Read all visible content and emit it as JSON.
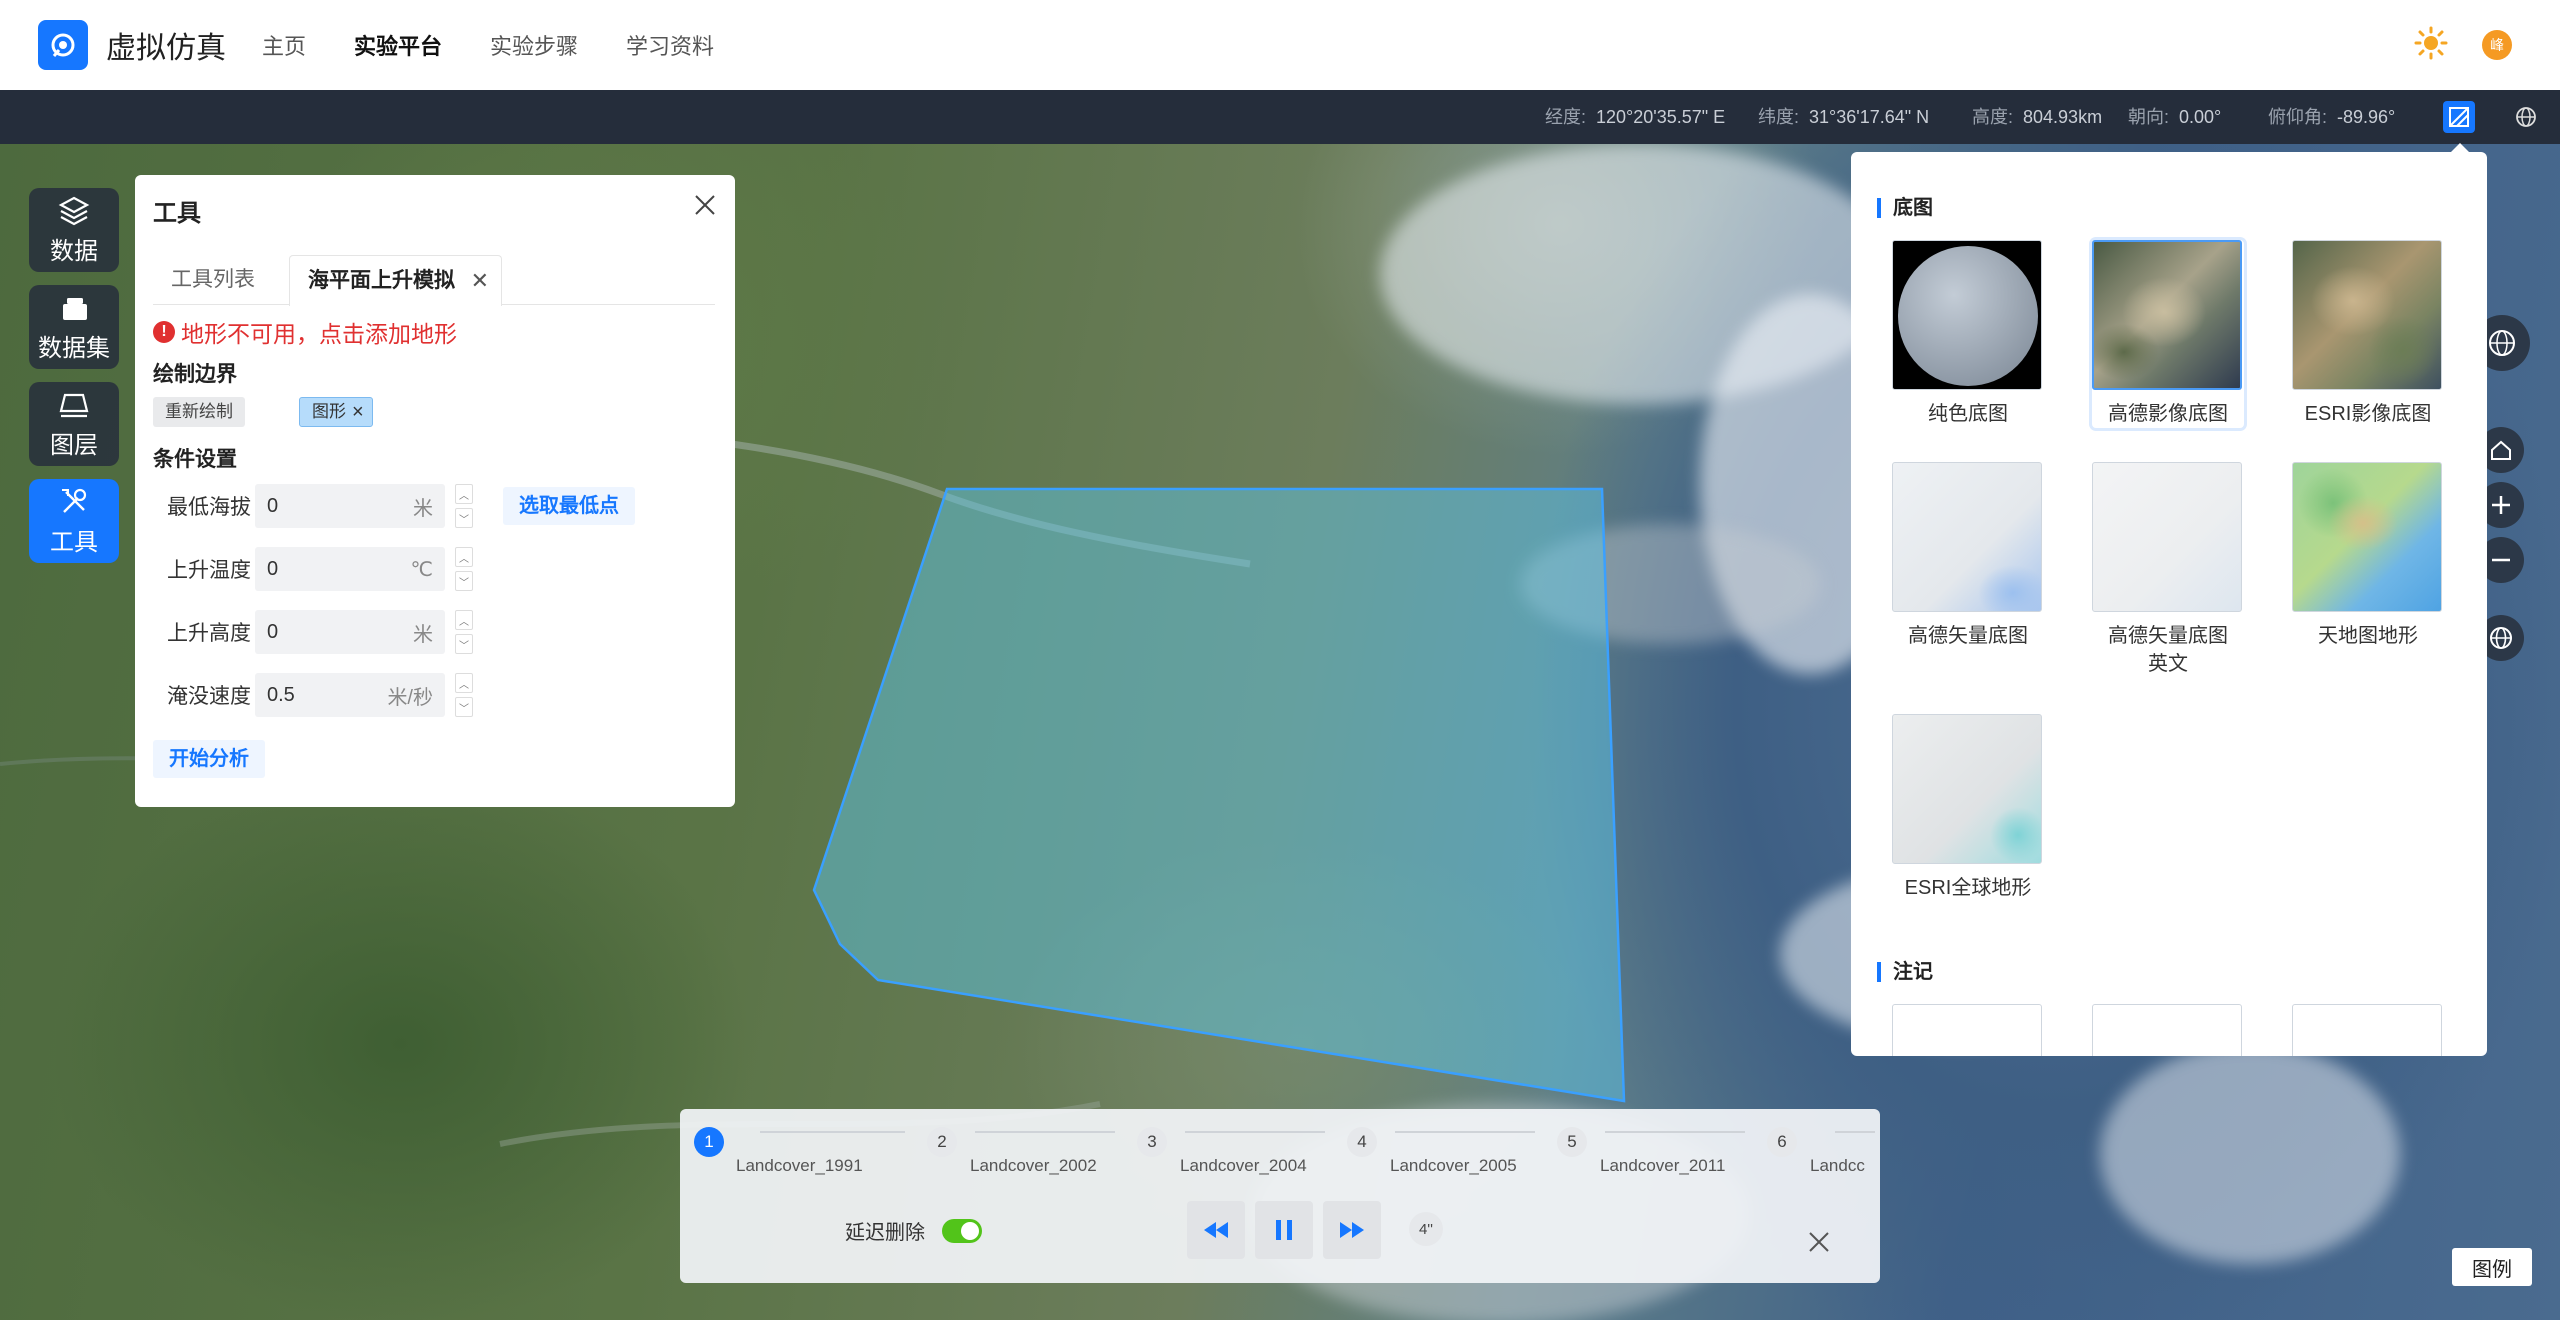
{
  "header": {
    "app_title": "虚拟仿真",
    "nav": [
      "主页",
      "实验平台",
      "实验步骤",
      "学习资料"
    ],
    "active_nav": "实验平台",
    "avatar_text": "峰"
  },
  "statusbar": {
    "longitude_label": "经度:",
    "longitude": "120°20'35.57\" E",
    "latitude_label": "纬度:",
    "latitude": "31°36'17.64\" N",
    "height_label": "高度:",
    "height": "804.93km",
    "heading_label": "朝向:",
    "heading": "0.00°",
    "pitch_label": "俯仰角:",
    "pitch": "-89.96°"
  },
  "sidebar": {
    "items": [
      {
        "label": "数据",
        "icon": "layers-icon"
      },
      {
        "label": "数据集",
        "icon": "dataset-icon"
      },
      {
        "label": "图层",
        "icon": "layer-icon"
      },
      {
        "label": "工具",
        "icon": "tools-icon"
      }
    ]
  },
  "tool_panel": {
    "title": "工具",
    "tabs": [
      "工具列表",
      "海平面上升模拟"
    ],
    "warning": "地形不可用，点击添加地形",
    "draw_section": "绘制边界",
    "redraw_label": "重新绘制",
    "shape_chip": "图形",
    "condition_section": "条件设置",
    "fields": [
      {
        "label": "最低海拔",
        "value": "0",
        "unit": "米"
      },
      {
        "label": "上升温度",
        "value": "0",
        "unit": "℃"
      },
      {
        "label": "上升高度",
        "value": "0",
        "unit": "米"
      },
      {
        "label": "淹没速度",
        "value": "0.5",
        "unit": "米/秒"
      }
    ],
    "pick_lowest_button": "选取最低点",
    "start_button": "开始分析"
  },
  "basemap_panel": {
    "section_basemap": "底图",
    "section_annotation": "注记",
    "items": [
      {
        "label": "纯色底图",
        "active": false
      },
      {
        "label": "高德影像底图",
        "active": true
      },
      {
        "label": "ESRI影像底图",
        "active": false
      },
      {
        "label": "高德矢量底图",
        "active": false
      },
      {
        "label": "高德矢量底图英文",
        "active": false
      },
      {
        "label": "天地图地形",
        "active": false
      },
      {
        "label": "ESRI全球地形",
        "active": false
      }
    ]
  },
  "timeline": {
    "steps": [
      {
        "num": "1",
        "label": "Landcover_1991"
      },
      {
        "num": "2",
        "label": "Landcover_2002"
      },
      {
        "num": "3",
        "label": "Landcover_2004"
      },
      {
        "num": "4",
        "label": "Landcover_2005"
      },
      {
        "num": "5",
        "label": "Landcover_2011"
      },
      {
        "num": "6",
        "label": "Landcc"
      }
    ],
    "active_step": 1,
    "delay_delete_label": "延迟删除",
    "delay_delete_on": true,
    "speed": "4''"
  },
  "legend_button": "图例",
  "colors": {
    "accent": "#1677ff",
    "warning": "#e03030",
    "polygon_fill": "#5fc7e8"
  }
}
